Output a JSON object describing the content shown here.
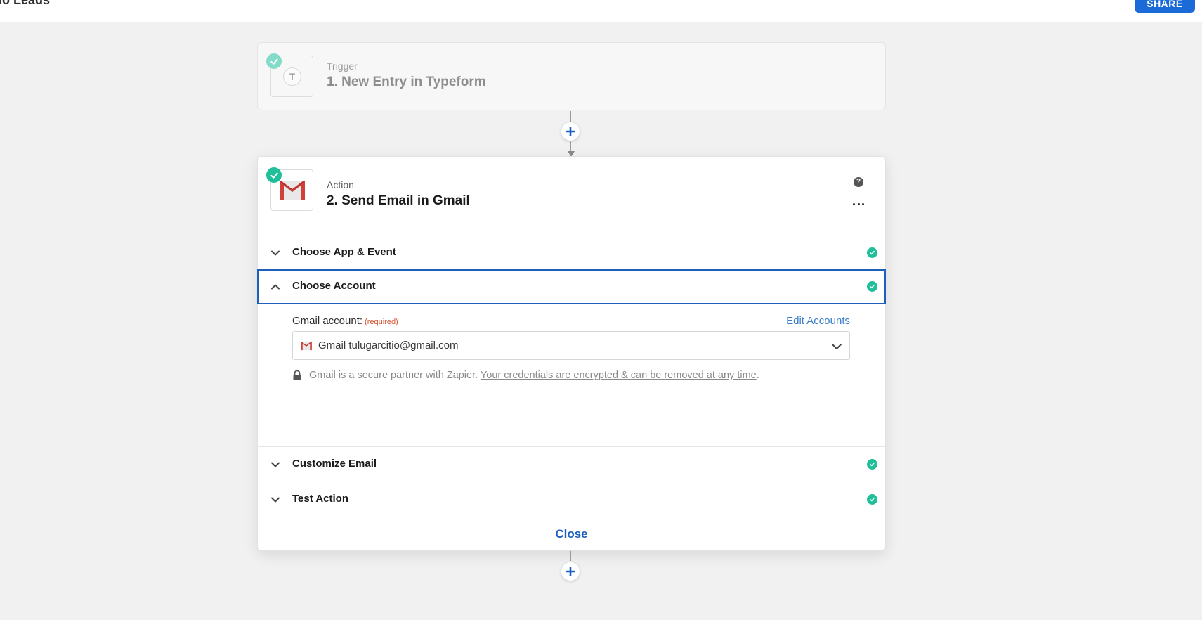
{
  "header": {
    "zap_title": "tio Leads",
    "share_label": "SHARE"
  },
  "trigger": {
    "kind": "Trigger",
    "name": "1. New Entry in Typeform",
    "app_letter": "T",
    "icon": "typeform-icon"
  },
  "action": {
    "kind": "Action",
    "name": "2. Send Email in Gmail",
    "icon": "gmail-icon",
    "help_glyph": "?"
  },
  "sections": [
    {
      "label": "Choose App & Event",
      "state": "collapsed",
      "complete": true
    },
    {
      "label": "Choose Account",
      "state": "expanded",
      "complete": true
    },
    {
      "label": "Customize Email",
      "state": "collapsed",
      "complete": true
    },
    {
      "label": "Test Action",
      "state": "collapsed",
      "complete": true
    }
  ],
  "account": {
    "field_label": "Gmail account:",
    "required_label": "(required)",
    "edit_accounts_label": "Edit Accounts",
    "selected_value": "Gmail tulugarcitio@gmail.com",
    "secure_text": "Gmail is a secure partner with Zapier. ",
    "secure_link": "Your credentials are encrypted & can be removed at any time",
    "secure_end": "."
  },
  "close_label": "Close",
  "colors": {
    "accent": "#1d5fbf",
    "success": "#1fbf99",
    "required": "#d2522b",
    "link": "#3a7dc9"
  }
}
